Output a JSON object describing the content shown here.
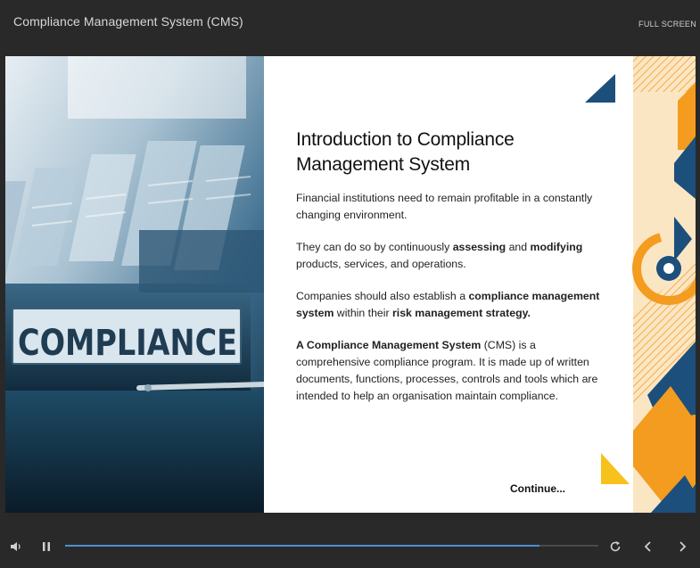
{
  "header": {
    "title": "Compliance Management System (CMS)",
    "fullscreen_label": "FULL SCREEN"
  },
  "slide": {
    "photo_text": "COMPLIANCE",
    "heading_line1": "Introduction to Compliance",
    "heading_line2": "Management System",
    "p1": "Financial institutions need to remain profitable in a constantly changing environment.",
    "p2": {
      "t1": "They can do so by continuously ",
      "b1": "assessing",
      "t2": " and ",
      "b2": "modifying",
      "t3": " products, services, and operations."
    },
    "p3": {
      "t1": "Companies should also establish a ",
      "b1": "compliance management system",
      "t2": " within their ",
      "b2": "risk management strategy."
    },
    "p4": {
      "b1": "A Compliance Management System",
      "t1": " (CMS) is a comprehensive compliance program. It is made up of written documents, functions, processes, controls and tools which are intended to help an organisation maintain compliance."
    },
    "continue_label": "Continue..."
  },
  "player": {
    "progress": 0.89,
    "accent_color": "#4f8fd1",
    "icons": [
      "volume-icon",
      "pause-icon",
      "replay-icon",
      "prev-icon",
      "next-icon"
    ]
  },
  "colors": {
    "background": "#292929",
    "navy": "#1d4f7c",
    "orange": "#f39c1f",
    "cream": "#fbe6c4",
    "yellow": "#f6c21b"
  }
}
